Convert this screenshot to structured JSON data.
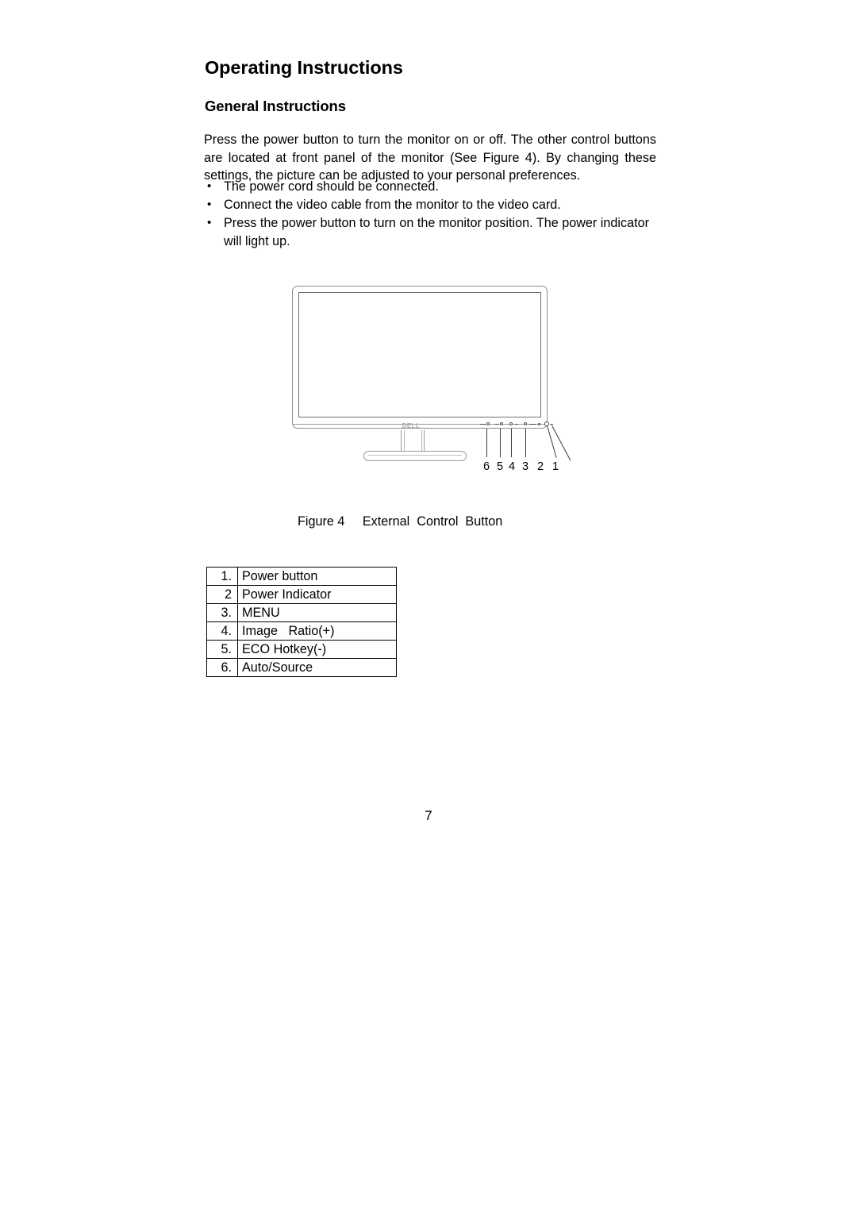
{
  "document": {
    "heading": "Operating Instructions",
    "subheading": "General Instructions",
    "paragraph": "Press the power button to turn the monitor on or off. The other control buttons are located at front panel of the monitor (See Figure 4). By changing these settings, the picture can be adjusted to your personal preferences.",
    "bullets": [
      "The power cord should be connected.",
      "Connect the video cable from the monitor to the video card.",
      "Press the power button to turn on the monitor position. The power indicator will light up."
    ],
    "bullet_marker": "•",
    "page_number": "7"
  },
  "figure": {
    "caption": "Figure 4     External  Control  Button",
    "caption_label": "Figure 4",
    "caption_title": "External  Control  Button",
    "logo_text": "DELL",
    "callouts": [
      "6",
      "5",
      "4",
      "3",
      "2",
      "1"
    ]
  },
  "table": {
    "rows": [
      {
        "num": "1.",
        "label": "Power button"
      },
      {
        "num": "2",
        "label": "Power Indicator"
      },
      {
        "num": "3.",
        "label": "MENU"
      },
      {
        "num": "4.",
        "label": "Image   Ratio(+)"
      },
      {
        "num": "5.",
        "label": "ECO Hotkey(-)"
      },
      {
        "num": "6.",
        "label": "Auto/Source"
      }
    ]
  },
  "colors": {
    "text": "#000000",
    "drawing_line": "#8d8d8d",
    "drawing_line_dark": "#4a4a4a",
    "table_border": "#000000",
    "logo": "#a8a8a8"
  }
}
